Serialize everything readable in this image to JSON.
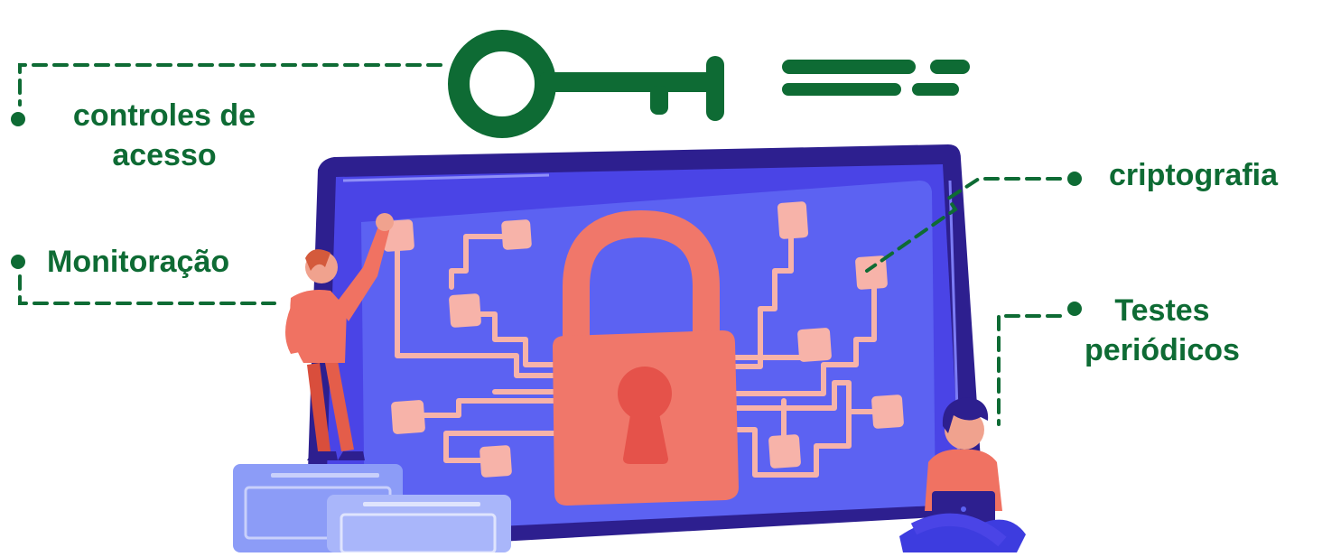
{
  "labels": {
    "access_controls": [
      "controles de",
      "acesso"
    ],
    "monitoring": "Monitoração",
    "cryptography": "criptografia",
    "periodic_tests": [
      "Testes",
      "periódicos"
    ]
  },
  "colors": {
    "brand_green": "#0e6b34",
    "laptop_frame": "#2d1f8f",
    "screen": "#5a5cf0",
    "lock": "#f0776a",
    "circuit": "#f7b3a9"
  },
  "icons": [
    "key-icon",
    "padlock-icon",
    "circuit-icon",
    "laptop-icon",
    "person-icon"
  ]
}
